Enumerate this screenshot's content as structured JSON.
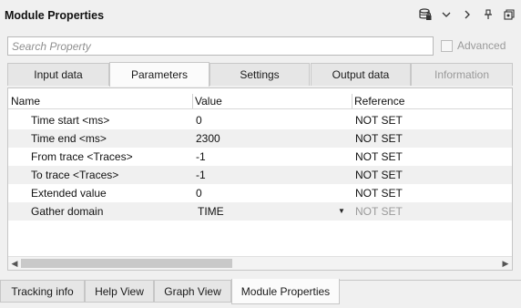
{
  "window": {
    "title": "Module Properties",
    "icons": [
      "database-lock-icon",
      "chevron-down-icon",
      "chevron-right-icon",
      "pin-icon",
      "restore-icon"
    ]
  },
  "search": {
    "placeholder": "Search Property",
    "value": ""
  },
  "advanced": {
    "label": "Advanced",
    "checked": false
  },
  "top_tabs": [
    {
      "label": "Input data",
      "active": false,
      "disabled": false
    },
    {
      "label": "Parameters",
      "active": true,
      "disabled": false
    },
    {
      "label": "Settings",
      "active": false,
      "disabled": false
    },
    {
      "label": "Output data",
      "active": false,
      "disabled": false
    },
    {
      "label": "Information",
      "active": false,
      "disabled": true
    }
  ],
  "table": {
    "headers": {
      "name": "Name",
      "value": "Value",
      "reference": "Reference"
    },
    "rows": [
      {
        "name": "Time start <ms>",
        "value": "0",
        "reference": "NOT SET"
      },
      {
        "name": "Time end <ms>",
        "value": "2300",
        "reference": "NOT SET"
      },
      {
        "name": "From trace <Traces>",
        "value": "-1",
        "reference": "NOT SET"
      },
      {
        "name": "To trace <Traces>",
        "value": "-1",
        "reference": "NOT SET"
      },
      {
        "name": "Extended value",
        "value": "0",
        "reference": "NOT SET"
      },
      {
        "name": "Gather domain",
        "value": "TIME",
        "reference": "NOT SET",
        "dropdown": true
      }
    ]
  },
  "bottom_tabs": [
    {
      "label": "Tracking info",
      "active": false
    },
    {
      "label": "Help View",
      "active": false
    },
    {
      "label": "Graph View",
      "active": false
    },
    {
      "label": "Module Properties",
      "active": true
    }
  ]
}
